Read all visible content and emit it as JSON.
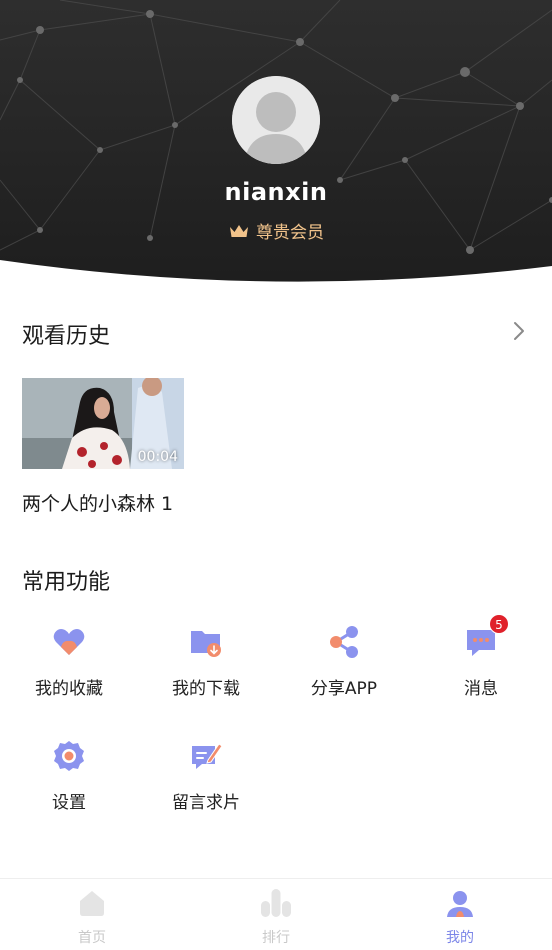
{
  "profile": {
    "username": "nianxin",
    "member_label": "尊贵会员"
  },
  "history": {
    "title": "观看历史",
    "items": [
      {
        "title": "两个人的小森林 1",
        "duration": "00:04"
      }
    ]
  },
  "functions": {
    "title": "常用功能",
    "items": [
      {
        "label": "我的收藏",
        "icon": "heart-icon"
      },
      {
        "label": "我的下载",
        "icon": "download-folder-icon"
      },
      {
        "label": "分享APP",
        "icon": "share-icon"
      },
      {
        "label": "消息",
        "icon": "message-icon",
        "badge": "5"
      },
      {
        "label": "设置",
        "icon": "settings-icon"
      },
      {
        "label": "留言求片",
        "icon": "feedback-icon"
      }
    ]
  },
  "tabbar": {
    "items": [
      {
        "label": "首页",
        "icon": "home-icon",
        "active": false
      },
      {
        "label": "排行",
        "icon": "ranking-icon",
        "active": false
      },
      {
        "label": "我的",
        "icon": "user-icon",
        "active": true
      }
    ]
  },
  "colors": {
    "accent": "#7c86e8",
    "accent_orange": "#f28c6c",
    "vip_gold": "#f1c38b",
    "header_dark": "#2a2a2a",
    "badge_red": "#e0212b"
  }
}
